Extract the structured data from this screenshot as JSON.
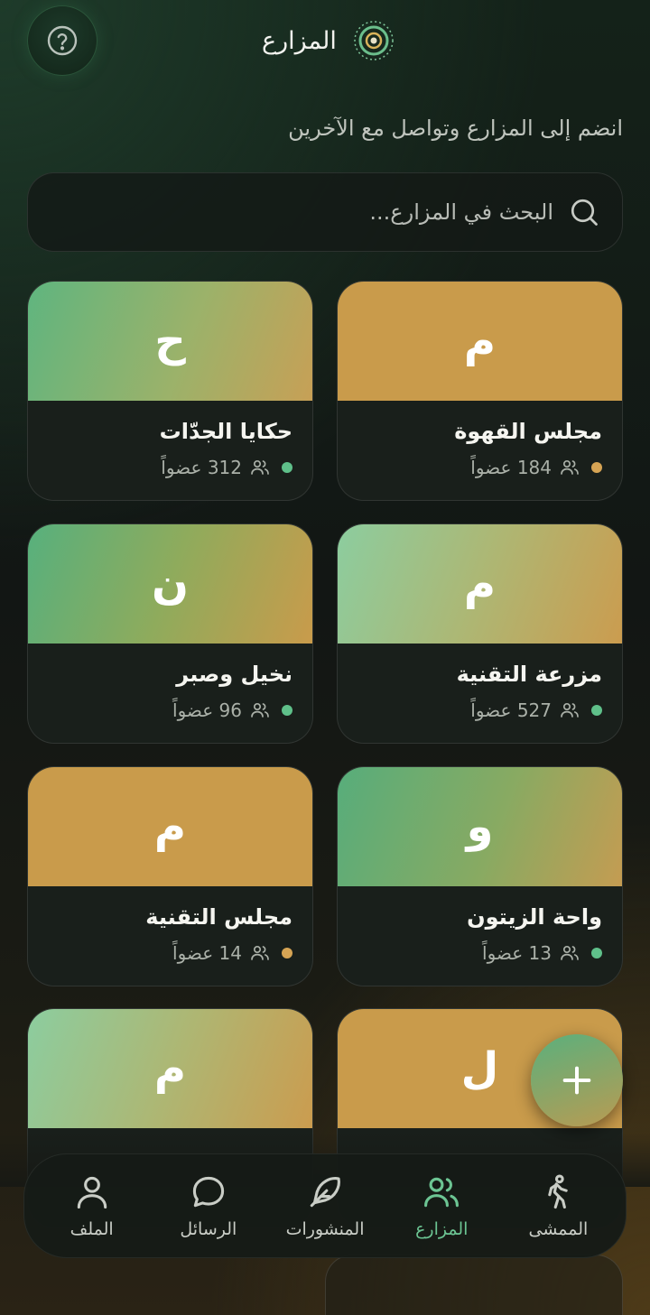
{
  "header": {
    "title": "المزارع"
  },
  "tagline": "انضم إلى المزارع وتواصل مع الآخرين",
  "search": {
    "placeholder": "البحث في المزارع..."
  },
  "colors": {
    "accent_green": "#5ab07d",
    "accent_gold": "#c99b4b",
    "dot_gold": "#d6a454",
    "dot_green": "#5fc08a"
  },
  "cards": [
    {
      "letter": "م",
      "name": "مجلس القهوة",
      "members": "184 عضواً",
      "dot": "gold"
    },
    {
      "letter": "ح",
      "name": "حكايا الجدّات",
      "members": "312 عضواً",
      "dot": "green"
    },
    {
      "letter": "م",
      "name": "مزرعة التقنية",
      "members": "527 عضواً",
      "dot": "green"
    },
    {
      "letter": "ن",
      "name": "نخيل وصبر",
      "members": "96 عضواً",
      "dot": "green"
    },
    {
      "letter": "و",
      "name": "واحة الزيتون",
      "members": "13 عضواً",
      "dot": "green"
    },
    {
      "letter": "م",
      "name": "مجلس التقنية",
      "members": "14 عضواً",
      "dot": "gold"
    },
    {
      "letter": "ل",
      "name": "",
      "members": "",
      "dot": ""
    },
    {
      "letter": "م",
      "name": "",
      "members": "",
      "dot": ""
    }
  ],
  "nav": [
    {
      "label": "الممشى",
      "icon": "walking-person-icon",
      "active": false
    },
    {
      "label": "المزارع",
      "icon": "users-icon",
      "active": true
    },
    {
      "label": "المنشورات",
      "icon": "feather-icon",
      "active": false
    },
    {
      "label": "الرسائل",
      "icon": "chat-bubble-icon",
      "active": false
    },
    {
      "label": "الملف",
      "icon": "user-icon",
      "active": false
    }
  ]
}
